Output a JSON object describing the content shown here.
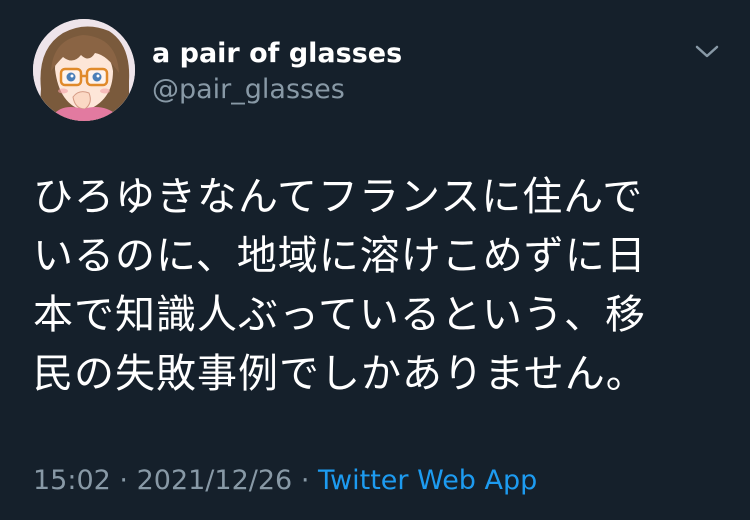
{
  "tweet": {
    "author": {
      "display_name": "a pair of glasses",
      "handle": "@pair_glasses",
      "avatar_icon": "anime-girl-glasses-avatar"
    },
    "menu_icon": "chevron-down-icon",
    "text_lines": [
      "ひろゆきなんてフランスに住んで",
      "いるのに、地域に溶けこめずに日",
      "本で知識人ぶっているという、移",
      "民の失敗事例でしかありません。"
    ],
    "time": "15:02",
    "date": "2021/12/26",
    "separator": "·",
    "source": "Twitter Web App"
  },
  "colors": {
    "background": "#15202b",
    "text": "#ffffff",
    "secondary": "#8899a6",
    "link": "#1d9bf0"
  }
}
